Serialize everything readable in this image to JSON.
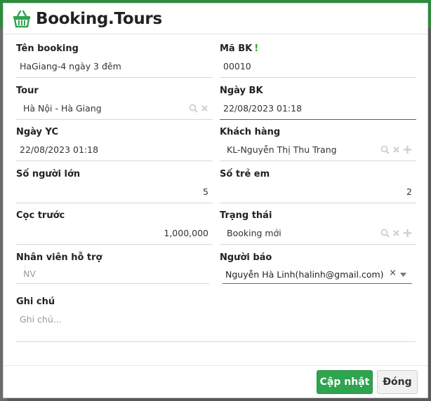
{
  "dialog": {
    "title": "Booking.Tours",
    "logo_icon": "basket-icon",
    "accent": "#2ea44f"
  },
  "fields": {
    "ten_booking": {
      "label": "Tên booking",
      "value": "HaGiang-4 ngày 3 đêm"
    },
    "ma_bk": {
      "label": "Mã BK",
      "required_mark": "!",
      "value": "00010"
    },
    "tour": {
      "label": "Tour",
      "value": "Hà Nội - Hà Giang"
    },
    "ngay_bk": {
      "label": "Ngày BK",
      "value": "22/08/2023 01:18"
    },
    "ngay_yc": {
      "label": "Ngày YC",
      "value": "22/08/2023 01:18"
    },
    "khach_hang": {
      "label": "Khách hàng",
      "value": "KL-Nguyễn Thị Thu Trang"
    },
    "so_nguoi_lon": {
      "label": "Số người lớn",
      "value": "5"
    },
    "so_tre_em": {
      "label": "Số trẻ em",
      "value": "2"
    },
    "coc_truoc": {
      "label": "Cọc trước",
      "value": "1,000,000"
    },
    "trang_thai": {
      "label": "Trạng thái",
      "value": "Booking mới"
    },
    "nhan_vien": {
      "label": "Nhân viên hỗ trợ",
      "placeholder": "NV"
    },
    "nguoi_bao": {
      "label": "Người báo",
      "value": "Nguyễn Hà Linh(halinh@gmail.com)",
      "clear": "×"
    },
    "ghi_chu": {
      "label": "Ghi chú",
      "placeholder": "Ghi chú..."
    }
  },
  "footer": {
    "update_label": "Cập nhật",
    "close_label": "Đóng"
  }
}
